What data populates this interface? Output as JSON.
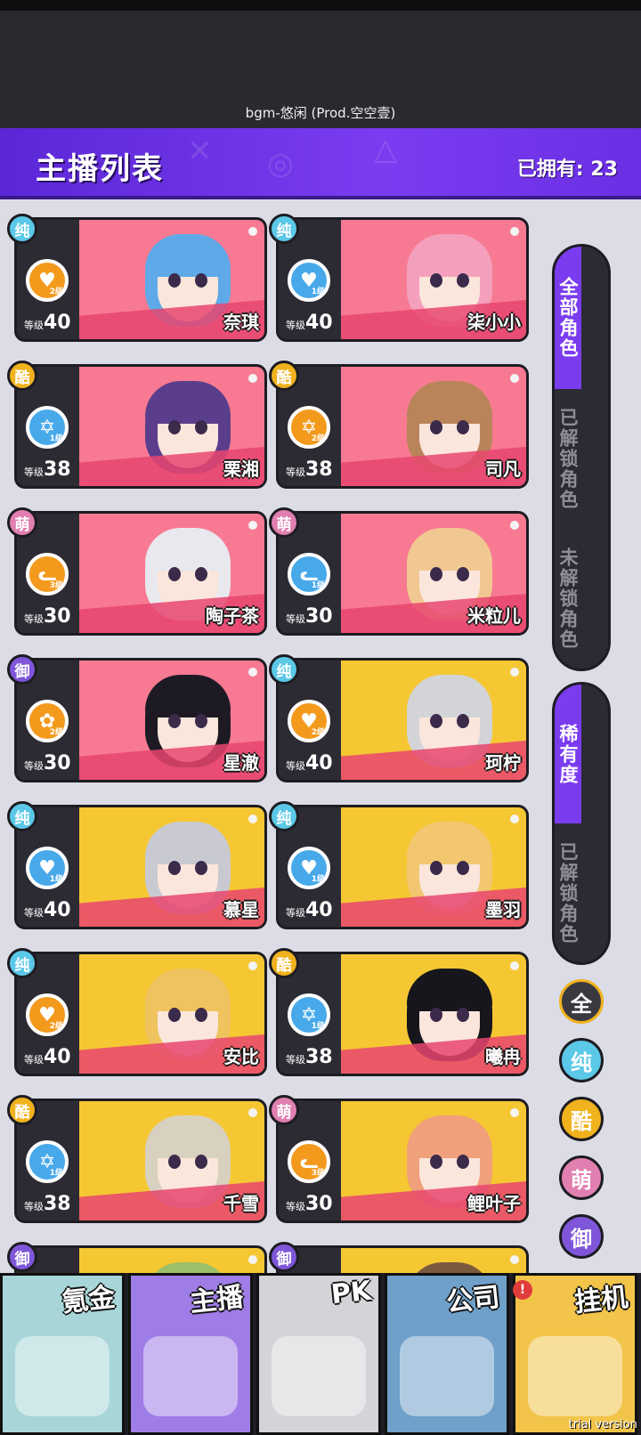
{
  "player": {
    "bgm_text": "bgm-悠闲 (Prod.空空壹)"
  },
  "header": {
    "title": "主播列表",
    "owned_label": "已拥有:",
    "owned_count": "23"
  },
  "level_label": "等级",
  "cards": [
    {
      "attr": "纯",
      "attr_key": "pure",
      "name": "奈琪",
      "level": "40",
      "skill": "heart-pulse-icon",
      "skill_color": "orange",
      "skill_sub": "2级",
      "bg": "pink",
      "hair": "#5fa9e8"
    },
    {
      "attr": "纯",
      "attr_key": "pure",
      "name": "柒小小",
      "level": "40",
      "skill": "heart-pulse-icon",
      "skill_color": "blue",
      "skill_sub": "1级",
      "bg": "pink",
      "hair": "#f4a0bc"
    },
    {
      "attr": "酷",
      "attr_key": "cool",
      "name": "栗湘",
      "level": "38",
      "skill": "star-of-david-icon",
      "skill_color": "blue",
      "skill_sub": "1级",
      "bg": "pink",
      "hair": "#5a3e8c"
    },
    {
      "attr": "酷",
      "attr_key": "cool",
      "name": "司凡",
      "level": "38",
      "skill": "star-of-david-icon",
      "skill_color": "orange",
      "skill_sub": "2级",
      "bg": "pink",
      "hair": "#b98459"
    },
    {
      "attr": "萌",
      "attr_key": "cute",
      "name": "陶子茶",
      "level": "30",
      "skill": "cat-face-icon",
      "skill_color": "orange",
      "skill_sub": "3级",
      "bg": "pink",
      "hair": "#e8e8ee"
    },
    {
      "attr": "萌",
      "attr_key": "cute",
      "name": "米粒儿",
      "level": "30",
      "skill": "cat-face-icon",
      "skill_color": "blue",
      "skill_sub": "1级",
      "bg": "pink",
      "hair": "#f1c891"
    },
    {
      "attr": "御",
      "attr_key": "royal",
      "name": "星澈",
      "level": "30",
      "skill": "rose-icon",
      "skill_color": "orange",
      "skill_sub": "2级",
      "bg": "pink",
      "hair": "#1e1a24"
    },
    {
      "attr": "纯",
      "attr_key": "pure",
      "name": "珂柠",
      "level": "40",
      "skill": "heart-pulse-icon",
      "skill_color": "orange",
      "skill_sub": "2级",
      "bg": "yellow",
      "hair": "#d2d4d8"
    },
    {
      "attr": "纯",
      "attr_key": "pure",
      "name": "慕星",
      "level": "40",
      "skill": "heart-pulse-icon",
      "skill_color": "blue",
      "skill_sub": "1级",
      "bg": "yellow",
      "hair": "#c9cad1"
    },
    {
      "attr": "纯",
      "attr_key": "pure",
      "name": "墨羽",
      "level": "40",
      "skill": "heart-pulse-icon",
      "skill_color": "blue",
      "skill_sub": "1级",
      "bg": "yellow",
      "hair": "#f3c770"
    },
    {
      "attr": "纯",
      "attr_key": "pure",
      "name": "安比",
      "level": "40",
      "skill": "heart-pulse-icon",
      "skill_color": "orange",
      "skill_sub": "2级",
      "bg": "yellow",
      "hair": "#efc35e"
    },
    {
      "attr": "酷",
      "attr_key": "cool",
      "name": "曦冉",
      "level": "38",
      "skill": "star-of-david-icon",
      "skill_color": "blue",
      "skill_sub": "1级",
      "bg": "yellow",
      "hair": "#16161c"
    },
    {
      "attr": "酷",
      "attr_key": "cool",
      "name": "千雪",
      "level": "38",
      "skill": "star-of-david-icon",
      "skill_color": "blue",
      "skill_sub": "1级",
      "bg": "yellow",
      "hair": "#d8d1c0"
    },
    {
      "attr": "萌",
      "attr_key": "cute",
      "name": "鲤叶子",
      "level": "30",
      "skill": "cat-face-icon",
      "skill_color": "orange",
      "skill_sub": "3级",
      "bg": "yellow",
      "hair": "#f0a07a"
    },
    {
      "attr": "御",
      "attr_key": "royal",
      "name": "",
      "level": "",
      "skill": "",
      "skill_color": "",
      "skill_sub": "",
      "bg": "yellow",
      "hair": "#9cbf6a"
    },
    {
      "attr": "御",
      "attr_key": "royal",
      "name": "",
      "level": "",
      "skill": "",
      "skill_color": "",
      "skill_sub": "",
      "bg": "yellow",
      "hair": "#7b5a40"
    }
  ],
  "side_filter": {
    "all_label": "全部角色",
    "unlocked_label": "已解锁角色",
    "locked_label": "未解锁角色",
    "rarity_label": "稀有度",
    "rarity_unlocked_label": "已解锁角色"
  },
  "attr_filters": [
    {
      "label": "全",
      "key": "all"
    },
    {
      "label": "纯",
      "key": "pure"
    },
    {
      "label": "酷",
      "key": "cool"
    },
    {
      "label": "萌",
      "key": "cute"
    },
    {
      "label": "御",
      "key": "royal"
    }
  ],
  "bottom_nav": [
    {
      "label": "氪金",
      "key": "shop",
      "bg": "#a8d6d8"
    },
    {
      "label": "主播",
      "key": "streamer",
      "bg": "#9f7de6"
    },
    {
      "label": "PK",
      "key": "pk",
      "bg": "#d4d4d8"
    },
    {
      "label": "公司",
      "key": "company",
      "bg": "#6fa0c9"
    },
    {
      "label": "挂机",
      "key": "idle",
      "bg": "#f2c44a"
    }
  ],
  "alert_badge": "!",
  "trial_text": "trial version",
  "colors": {
    "accent": "#7b3cf0",
    "pink_bg": "#f77a92",
    "yellow_bg": "#f5c733",
    "pure": "#5bc8e8",
    "cool": "#f0b21d",
    "cute": "#e07fb0",
    "royal": "#7f56d9"
  }
}
